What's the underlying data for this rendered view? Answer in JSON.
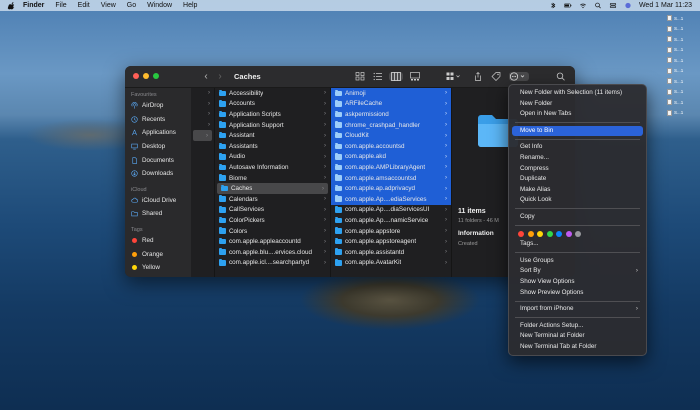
{
  "menubar": {
    "menus": [
      "Finder",
      "File",
      "Edit",
      "View",
      "Go",
      "Window",
      "Help"
    ],
    "clock": "Wed 1 Mar  11:23"
  },
  "desktop_icons": [
    "S...1",
    "S...1",
    "S...1",
    "S...1",
    "S...1",
    "S...1",
    "S...1",
    "S...1",
    "S...1",
    "S...1"
  ],
  "window": {
    "title": "Caches"
  },
  "sidebar": {
    "favourites_header": "Favourites",
    "favourites": [
      {
        "label": "AirDrop",
        "icon": "airdrop-icon"
      },
      {
        "label": "Recents",
        "icon": "clock-icon"
      },
      {
        "label": "Applications",
        "icon": "applications-icon"
      },
      {
        "label": "Desktop",
        "icon": "desktop-icon"
      },
      {
        "label": "Documents",
        "icon": "document-icon"
      },
      {
        "label": "Downloads",
        "icon": "download-icon"
      }
    ],
    "icloud_header": "iCloud",
    "icloud": [
      {
        "label": "iCloud Drive",
        "icon": "cloud-icon"
      },
      {
        "label": "Shared",
        "icon": "shared-folder-icon"
      }
    ],
    "tags_header": "Tags",
    "tags": [
      {
        "label": "Red",
        "color": "#ff453a"
      },
      {
        "label": "Orange",
        "color": "#ff9f0a"
      },
      {
        "label": "Yellow",
        "color": "#ffd60a"
      }
    ]
  },
  "column2": [
    "Accessibility",
    "Accounts",
    "Application Scripts",
    "Application Support",
    "Assistant",
    "Assistants",
    "Audio",
    "Autosave Information",
    "Biome",
    "Caches",
    "Calendars",
    "CallServices",
    "ColorPickers",
    "Colors",
    "com.apple.appleaccountd",
    "com.apple.blu....ervices.cloud",
    "com.apple.icl....searchpartyd"
  ],
  "column3": [
    "Animoji",
    "ARFileCache",
    "askpermissiond",
    "chrome_crashpad_handler",
    "CloudKit",
    "com.apple.accountsd",
    "com.apple.akd",
    "com.apple.AMPLibraryAgent",
    "com.apple.amsaccountsd",
    "com.apple.ap.adprivacyd",
    "com.apple.Ap....ediaServices",
    "com.apple.Ap....diaServicesUI",
    "com.apple.Ap....namicService",
    "com.apple.appstore",
    "com.apple.appstoreagent",
    "com.apple.assistantd",
    "com.apple.AvatarKit"
  ],
  "preview": {
    "count": "11 items",
    "sub": "11 folders - 46 M",
    "info": "Information",
    "created": "Created"
  },
  "context_menu": {
    "group1": [
      "New Folder with Selection (11 items)",
      "New Folder",
      "Open in New Tabs"
    ],
    "group2": [
      "Move to Bin"
    ],
    "group3": [
      "Get Info",
      "Rename...",
      "Compress",
      "Duplicate",
      "Make Alias",
      "Quick Look"
    ],
    "group4": [
      "Copy"
    ],
    "tag_colors": [
      "#ff453a",
      "#ff9f0a",
      "#ffd60a",
      "#32d74b",
      "#0a84ff",
      "#bf5af2",
      "#98989d"
    ],
    "tags_label": "Tags...",
    "group6": [
      "Use Groups",
      "Sort By",
      "Show View Options",
      "Show Preview Options"
    ],
    "group7": [
      "Import from iPhone"
    ],
    "group8": [
      "Folder Actions Setup...",
      "New Terminal at Folder",
      "New Terminal Tab at Folder"
    ]
  },
  "colors": {
    "selection_blue": "#1f5fd6",
    "menu_highlight": "#2b63d9",
    "folder_blue": "#2da1f0"
  }
}
